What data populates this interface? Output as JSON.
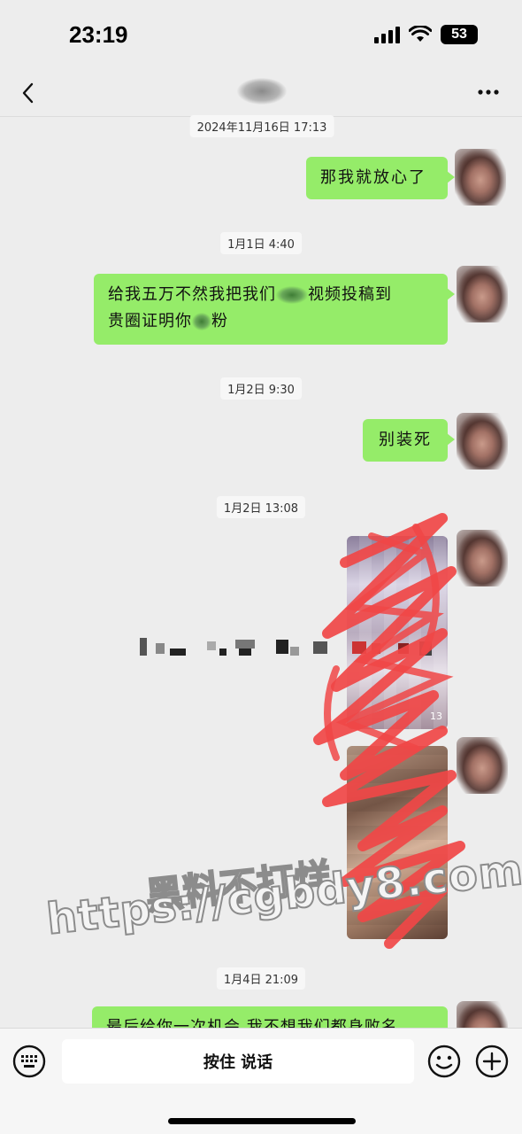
{
  "status": {
    "time": "23:19",
    "battery": "53"
  },
  "messages": [
    {
      "time": "2024年11月16日 17:13",
      "text": "那我就放心了"
    },
    {
      "time": "1月1日 4:40",
      "text_line1_a": "给我五万不然我把我们",
      "text_line1_b": "视频投稿到",
      "text_line2_a": "贵圈证明你",
      "text_line2_b": "粉"
    },
    {
      "time": "1月2日 9:30",
      "text": "别装死"
    },
    {
      "time": "1月2日 13:08",
      "media_caption": "13"
    },
    {
      "time": "1月4日 21:09",
      "text": "最后给你一次机会,我不想我们都身败名"
    }
  ],
  "watermark": {
    "line1": "黑料不打烊",
    "line2": "https://cgbdy8.com"
  },
  "input": {
    "press_to_talk": "按住 说话"
  }
}
